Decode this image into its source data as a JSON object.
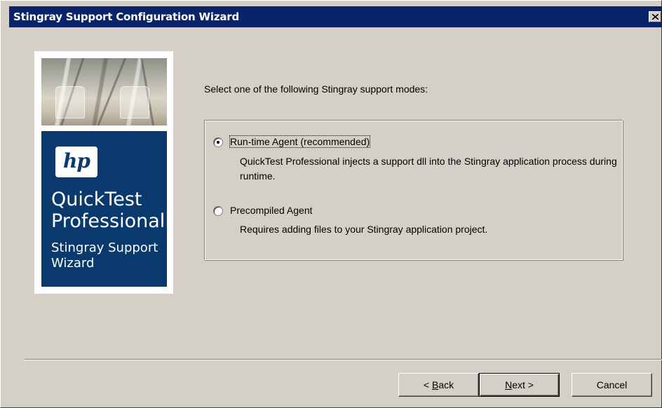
{
  "window": {
    "title": "Stingray Support Configuration Wizard"
  },
  "banner": {
    "logo_text": "hp",
    "product_line1": "QuickTest",
    "product_line2": "Professional",
    "subtitle_line1": "Stingray Support",
    "subtitle_line2": "Wizard"
  },
  "main": {
    "prompt": "Select one of the following Stingray support modes:",
    "options": [
      {
        "label": "Run-time Agent (recommended)",
        "description": "QuickTest Professional injects a support dll into the Stingray application process during runtime.",
        "selected": true
      },
      {
        "label": "Precompiled Agent",
        "description": "Requires adding files to your Stingray application project.",
        "selected": false
      }
    ]
  },
  "footer": {
    "back_prefix": "< ",
    "back_mnemonic": "B",
    "back_rest": "ack",
    "next_mnemonic": "N",
    "next_rest": "ext >",
    "cancel_label": "Cancel"
  },
  "colors": {
    "titlebar": "#0a246a",
    "dialog_bg": "#d4d0c8",
    "brand_blue": "#0a3a6d"
  }
}
